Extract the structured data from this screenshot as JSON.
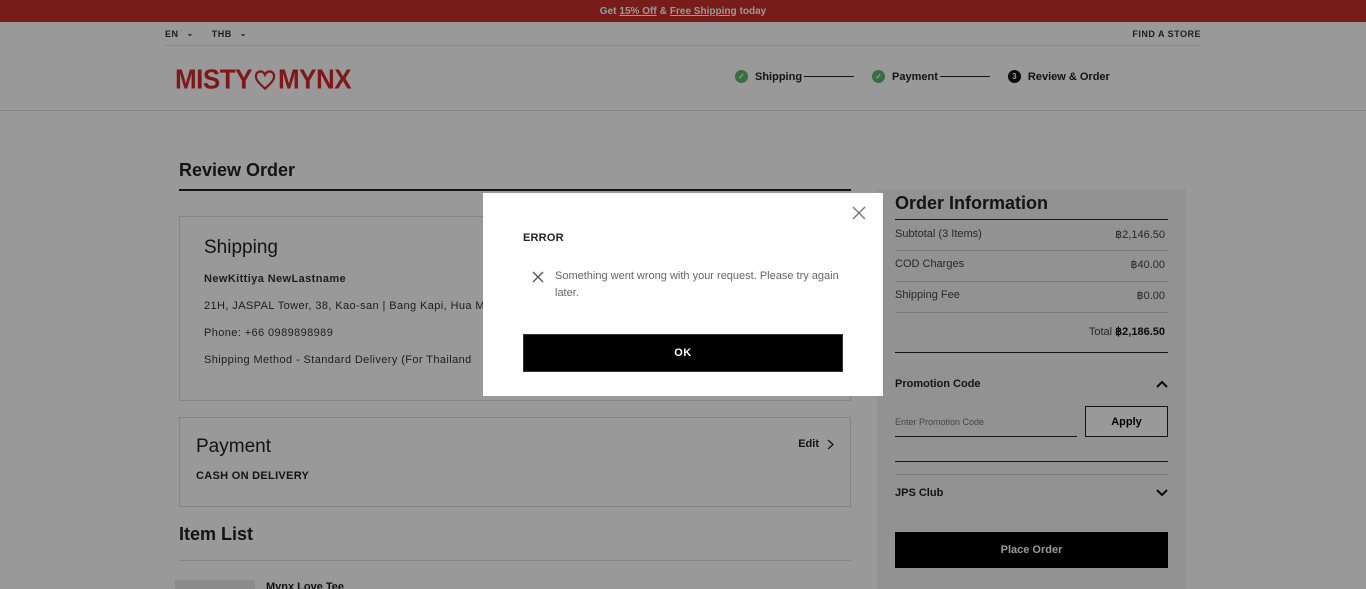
{
  "promo_bar": {
    "prefix": "Get",
    "offer_link": "15% Off",
    "ampersand": "&",
    "shipping_link": "Free Shipping",
    "suffix": "today"
  },
  "utility": {
    "language": "EN",
    "currency": "THB",
    "find_store": "FIND A STORE"
  },
  "brand": {
    "left": "MISTY",
    "right": "MYNX",
    "color": "#d6282c"
  },
  "checkout_steps": [
    {
      "label": "Shipping",
      "status": "done",
      "icon": "check-icon"
    },
    {
      "label": "Payment",
      "status": "done",
      "icon": "check-icon"
    },
    {
      "label": "Review & Order",
      "status": "current",
      "number": "3"
    }
  ],
  "review": {
    "title": "Review Order",
    "shipping": {
      "heading": "Shipping",
      "name": "NewKittiya NewLastname",
      "address": "21H, JASPAL Tower, 38, Kao-san | Bang Kapi, Hua M",
      "phone": "Phone: +66 0989898989",
      "method": "Shipping Method  - Standard Delivery (For Thailand"
    },
    "payment": {
      "heading": "Payment",
      "edit_label": "Edit",
      "method": "CASH ON DELIVERY"
    },
    "item_list": {
      "heading": "Item List",
      "first_item": "Mynx Love Tee"
    }
  },
  "order_info": {
    "title": "Order Information",
    "rows": [
      {
        "label": "Subtotal (3 Items)",
        "value": "฿2,146.50"
      },
      {
        "label": "COD Charges",
        "value": "฿40.00"
      },
      {
        "label": "Shipping Fee",
        "value": "฿0.00"
      }
    ],
    "total_label": "Total",
    "total_value": "฿2,186.50",
    "promotion": {
      "heading": "Promotion Code",
      "placeholder": "Enter Promotion Code",
      "apply_label": "Apply"
    },
    "club": {
      "heading": "JPS Club"
    },
    "place_order_label": "Place Order"
  },
  "error_modal": {
    "title": "ERROR",
    "message": "Something went wrong with your request. Please try again later.",
    "ok_label": "OK"
  }
}
